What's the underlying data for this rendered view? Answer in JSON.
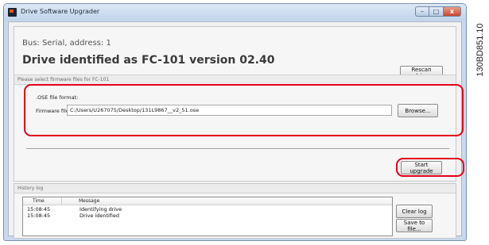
{
  "window": {
    "title": "Drive Software Upgrader",
    "buttons": [
      "–",
      "□",
      "x"
    ]
  },
  "connection": {
    "bus_text": "Bus: Serial, address: 1",
    "drive_text": "Drive identified as FC-101 version 02.40",
    "rescan_label": "Rescan drive"
  },
  "firmware": {
    "section_label": "Please select firmware files for FC-101",
    "format_label": ".OSE file format:",
    "file_label": "Firmware file:",
    "file_value": "C:/Users/U267075/Desktop/131L9867__v2_51.ose",
    "browse_label": "Browse...",
    "start_label": "Start upgrade"
  },
  "history": {
    "section_label": "History log",
    "columns": {
      "time": "Time",
      "message": "Message"
    },
    "rows": [
      {
        "time": "15:08:45",
        "message": "Identifying drive"
      },
      {
        "time": "15:08:45",
        "message": "Drive identified"
      }
    ],
    "clear_label": "Clear log",
    "save_label": "Save to file..."
  },
  "figure_code": "130BD851.10",
  "colors": {
    "highlight": "#e4001b",
    "title_bar": "#c9d8ec"
  },
  "icons": [
    "app-icon",
    "minimize-icon",
    "maximize-icon",
    "close-icon"
  ]
}
